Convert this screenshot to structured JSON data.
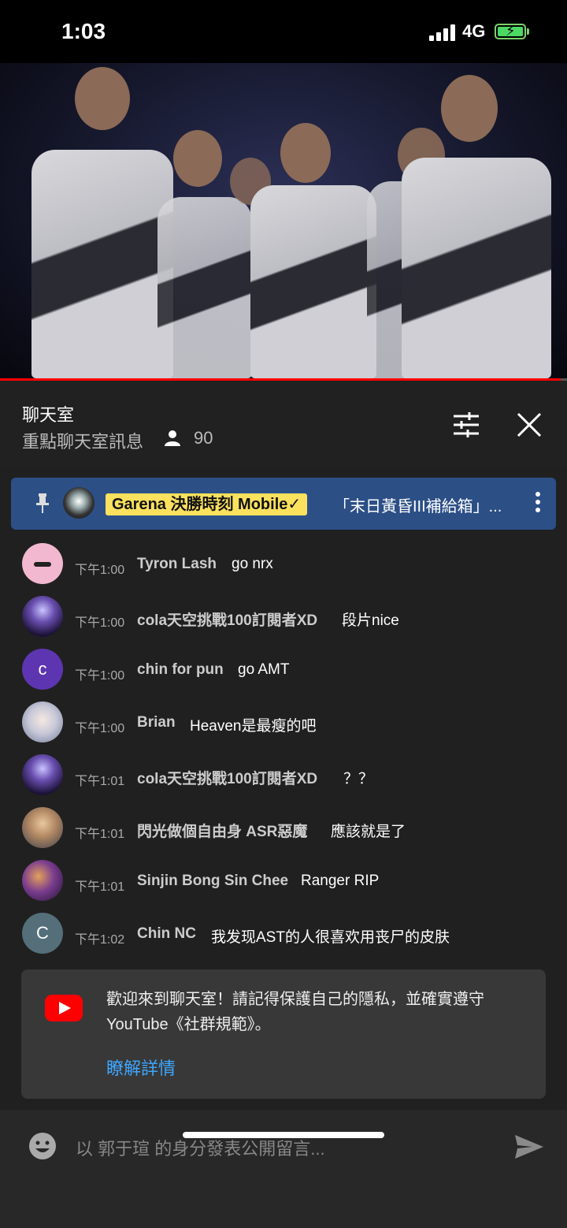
{
  "status_bar": {
    "time": "1:03",
    "network": "4G"
  },
  "chat": {
    "title": "聊天室",
    "mode": "重點聊天室訊息",
    "viewer_count": "90"
  },
  "pinned": {
    "author": "Garena 決勝時刻 Mobile✓",
    "message": "「末日黃昏III補給箱」..."
  },
  "messages": [
    {
      "time": "下午1:00",
      "author": "Tyron Lash",
      "text": "go nrx",
      "avatar_color": "#f2b8cf"
    },
    {
      "time": "下午1:00",
      "author": "cola天空挑戰100訂閱者XD",
      "text": "段片nice",
      "avatar_color": "#3b2a5e"
    },
    {
      "time": "下午1:00",
      "author": "chin for pun",
      "text": "go AMT",
      "avatar_letter": "c",
      "avatar_color": "#5e35b1"
    },
    {
      "time": "下午1:00",
      "author": "Brian",
      "text": "Heaven是最瘦的吧",
      "avatar_color": "#c8c8d8"
    },
    {
      "time": "下午1:01",
      "author": "cola天空挑戰100訂閱者XD",
      "text": "？？",
      "avatar_color": "#3b2a5e"
    },
    {
      "time": "下午1:01",
      "author": "閃光做個自由身 ASR惡魔",
      "text": "應該就是了",
      "avatar_color": "#c9a07a"
    },
    {
      "time": "下午1:01",
      "author": "Sinjin Bong Sin Chee",
      "text": "Ranger RIP",
      "avatar_color": "#6b3f8a"
    },
    {
      "time": "下午1:02",
      "author": "Chin NC",
      "text": "我发现AST的人很喜欢用丧尸的皮肤",
      "avatar_letter": "C",
      "avatar_color": "#546e7a"
    }
  ],
  "welcome": {
    "text": "歡迎來到聊天室！請記得保護自己的隱私，並確實遵守 YouTube《社群規範》。",
    "link": "瞭解詳情"
  },
  "composer": {
    "placeholder": "以 郭于瑄 的身分發表公開留言..."
  }
}
